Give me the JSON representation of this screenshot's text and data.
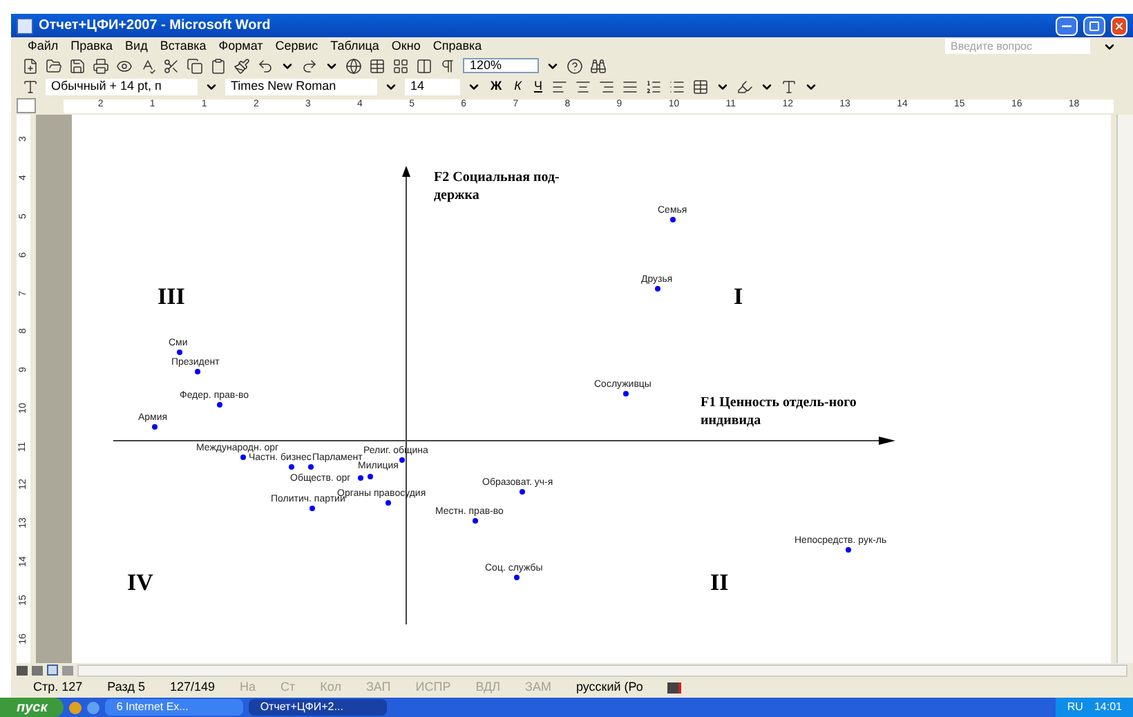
{
  "window": {
    "title": "Отчет+ЦФИ+2007 - Microsoft Word"
  },
  "menu": [
    "Файл",
    "Правка",
    "Вид",
    "Вставка",
    "Формат",
    "Сервис",
    "Таблица",
    "Окно",
    "Справка"
  ],
  "help_search": {
    "placeholder": "Введите вопрос"
  },
  "standard_toolbar": {
    "zoom": "120%"
  },
  "formatting_toolbar": {
    "style": "Обычный + 14 pt, п",
    "font": "Times New Roman",
    "size": "14",
    "bold": "Ж",
    "italic": "К",
    "underline": "Ч"
  },
  "ruler": {
    "horizontal": [
      "2",
      "1",
      "1",
      "2",
      "3",
      "4",
      "5",
      "6",
      "7",
      "8",
      "9",
      "10",
      "11",
      "12",
      "13",
      "14",
      "15",
      "16",
      "18"
    ],
    "vertical": [
      "3",
      "4",
      "5",
      "6",
      "7",
      "8",
      "9",
      "10",
      "11",
      "12",
      "13",
      "14",
      "15",
      "16"
    ]
  },
  "figure": {
    "y_axis": "F2 Социальная под-держка",
    "x_axis": "F1 Ценность отдель-ного индивида",
    "quadrants": [
      "III",
      "I",
      "IV",
      "II"
    ],
    "points": [
      {
        "label": "Семья"
      },
      {
        "label": "Друзья"
      },
      {
        "label": "Сослуживцы"
      },
      {
        "label": "Сми"
      },
      {
        "label": "Президент"
      },
      {
        "label": "Федер. прав-во"
      },
      {
        "label": "Армия"
      },
      {
        "label": "Международн. орг"
      },
      {
        "label": "Частн. бизнес"
      },
      {
        "label": "Парламент"
      },
      {
        "label": "Религ. община"
      },
      {
        "label": "Милиция"
      },
      {
        "label": "Обществ. орг"
      },
      {
        "label": "Органы правосудия"
      },
      {
        "label": "Политич. партии"
      },
      {
        "label": "Образоват. уч-я"
      },
      {
        "label": "Местн. прав-во"
      },
      {
        "label": "Соц. службы"
      },
      {
        "label": "Непосредств. рук-ль"
      }
    ]
  },
  "status_bar": [
    {
      "text": "Стр. 127",
      "disabled": false
    },
    {
      "text": "Разд 5",
      "disabled": false
    },
    {
      "text": "127/149",
      "disabled": false
    },
    {
      "text": "На",
      "disabled": true
    },
    {
      "text": "Ст",
      "disabled": true
    },
    {
      "text": "Кол",
      "disabled": true
    },
    {
      "text": "ЗАП",
      "disabled": true
    },
    {
      "text": "ИСПР",
      "disabled": true
    },
    {
      "text": "ВДЛ",
      "disabled": true
    },
    {
      "text": "ЗАМ",
      "disabled": true
    },
    {
      "text": "русский (Ро",
      "disabled": false
    }
  ],
  "taskbar": {
    "start": "пуск",
    "tasks": [
      {
        "label": "6 Internet Ex...",
        "selected": false
      },
      {
        "label": "Отчет+ЦФИ+2...",
        "selected": true
      }
    ],
    "language": "RU",
    "clock": "14:01"
  }
}
